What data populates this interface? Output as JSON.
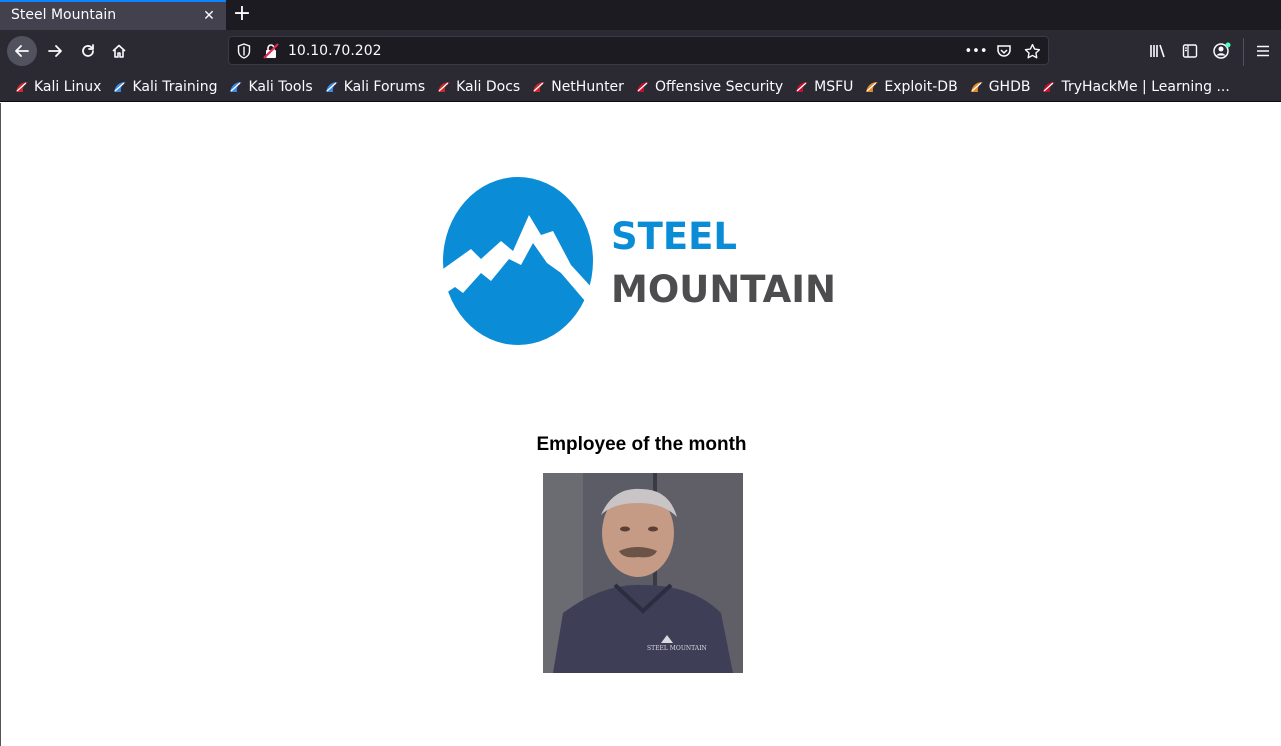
{
  "tab": {
    "title": "Steel Mountain",
    "close_icon": "close-icon"
  },
  "navbar": {
    "url": "10.10.70.202"
  },
  "bookmarks": [
    {
      "label": "Kali Linux",
      "icon": "kali-dragon-icon",
      "color": "#d0282f"
    },
    {
      "label": "Kali Training",
      "icon": "kali-training-icon",
      "color": "#3c8ce7"
    },
    {
      "label": "Kali Tools",
      "icon": "kali-tools-icon",
      "color": "#3c8ce7"
    },
    {
      "label": "Kali Forums",
      "icon": "kali-forums-icon",
      "color": "#3c8ce7"
    },
    {
      "label": "Kali Docs",
      "icon": "kali-docs-icon",
      "color": "#d0282f"
    },
    {
      "label": "NetHunter",
      "icon": "nethunter-icon",
      "color": "#d0282f"
    },
    {
      "label": "Offensive Security",
      "icon": "offsec-icon",
      "color": "#c8102e"
    },
    {
      "label": "MSFU",
      "icon": "msfu-icon",
      "color": "#c8102e"
    },
    {
      "label": "Exploit-DB",
      "icon": "exploit-db-icon",
      "color": "#e8892b"
    },
    {
      "label": "GHDB",
      "icon": "ghdb-icon",
      "color": "#e8892b"
    },
    {
      "label": "TryHackMe | Learning ...",
      "icon": "tryhackme-icon",
      "color": "#c8102e"
    }
  ],
  "page": {
    "logo_line1": "STEEL",
    "logo_line2": "MOUNTAIN",
    "heading": "Employee of the month",
    "brand_blue": "#0a8dd6",
    "brand_gray": "#4d4d4f"
  }
}
